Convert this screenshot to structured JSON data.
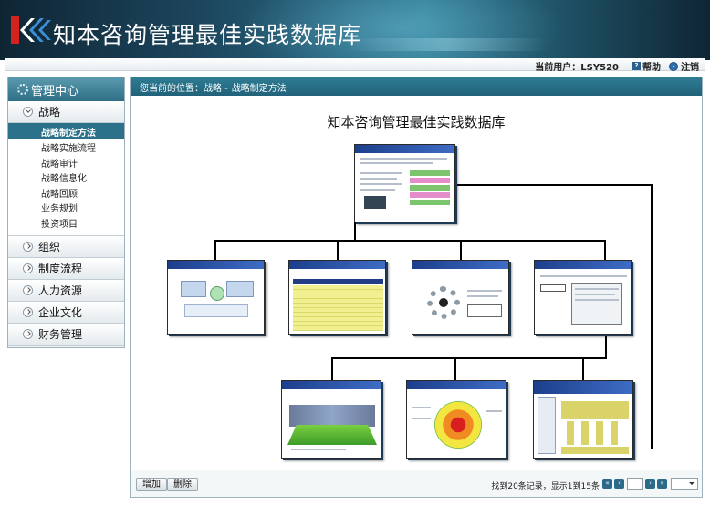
{
  "app": {
    "title": "知本咨询管理最佳实践数据库"
  },
  "userbar": {
    "user": "当前用户：LSY520",
    "help": "帮助",
    "logout": "注销"
  },
  "sidebar": {
    "header": "管理中心",
    "categories": [
      {
        "label": "战略",
        "expanded": true,
        "active_sub": "战略制定方法",
        "items": [
          "战略实施流程",
          "战略审计",
          "战略信息化",
          "战略回顾",
          "业务规划",
          "投资项目"
        ]
      },
      {
        "label": "组织",
        "expanded": false
      },
      {
        "label": "制度流程",
        "expanded": false
      },
      {
        "label": "人力资源",
        "expanded": false
      },
      {
        "label": "企业文化",
        "expanded": false
      },
      {
        "label": "财务管理",
        "expanded": false
      }
    ]
  },
  "breadcrumb": {
    "prefix": "您当前的位置：战略 -",
    "current": "战略制定方法"
  },
  "diagram": {
    "title": "知本咨询管理最佳实践数据库"
  },
  "footer": {
    "add_button": "增加",
    "delete_button": "删除",
    "record_info": "找到20条记录，显示1到15条"
  },
  "colors": {
    "header_dark": "#0f2534",
    "accent": "#2b7189",
    "slide_header": "#1c3f8c"
  }
}
